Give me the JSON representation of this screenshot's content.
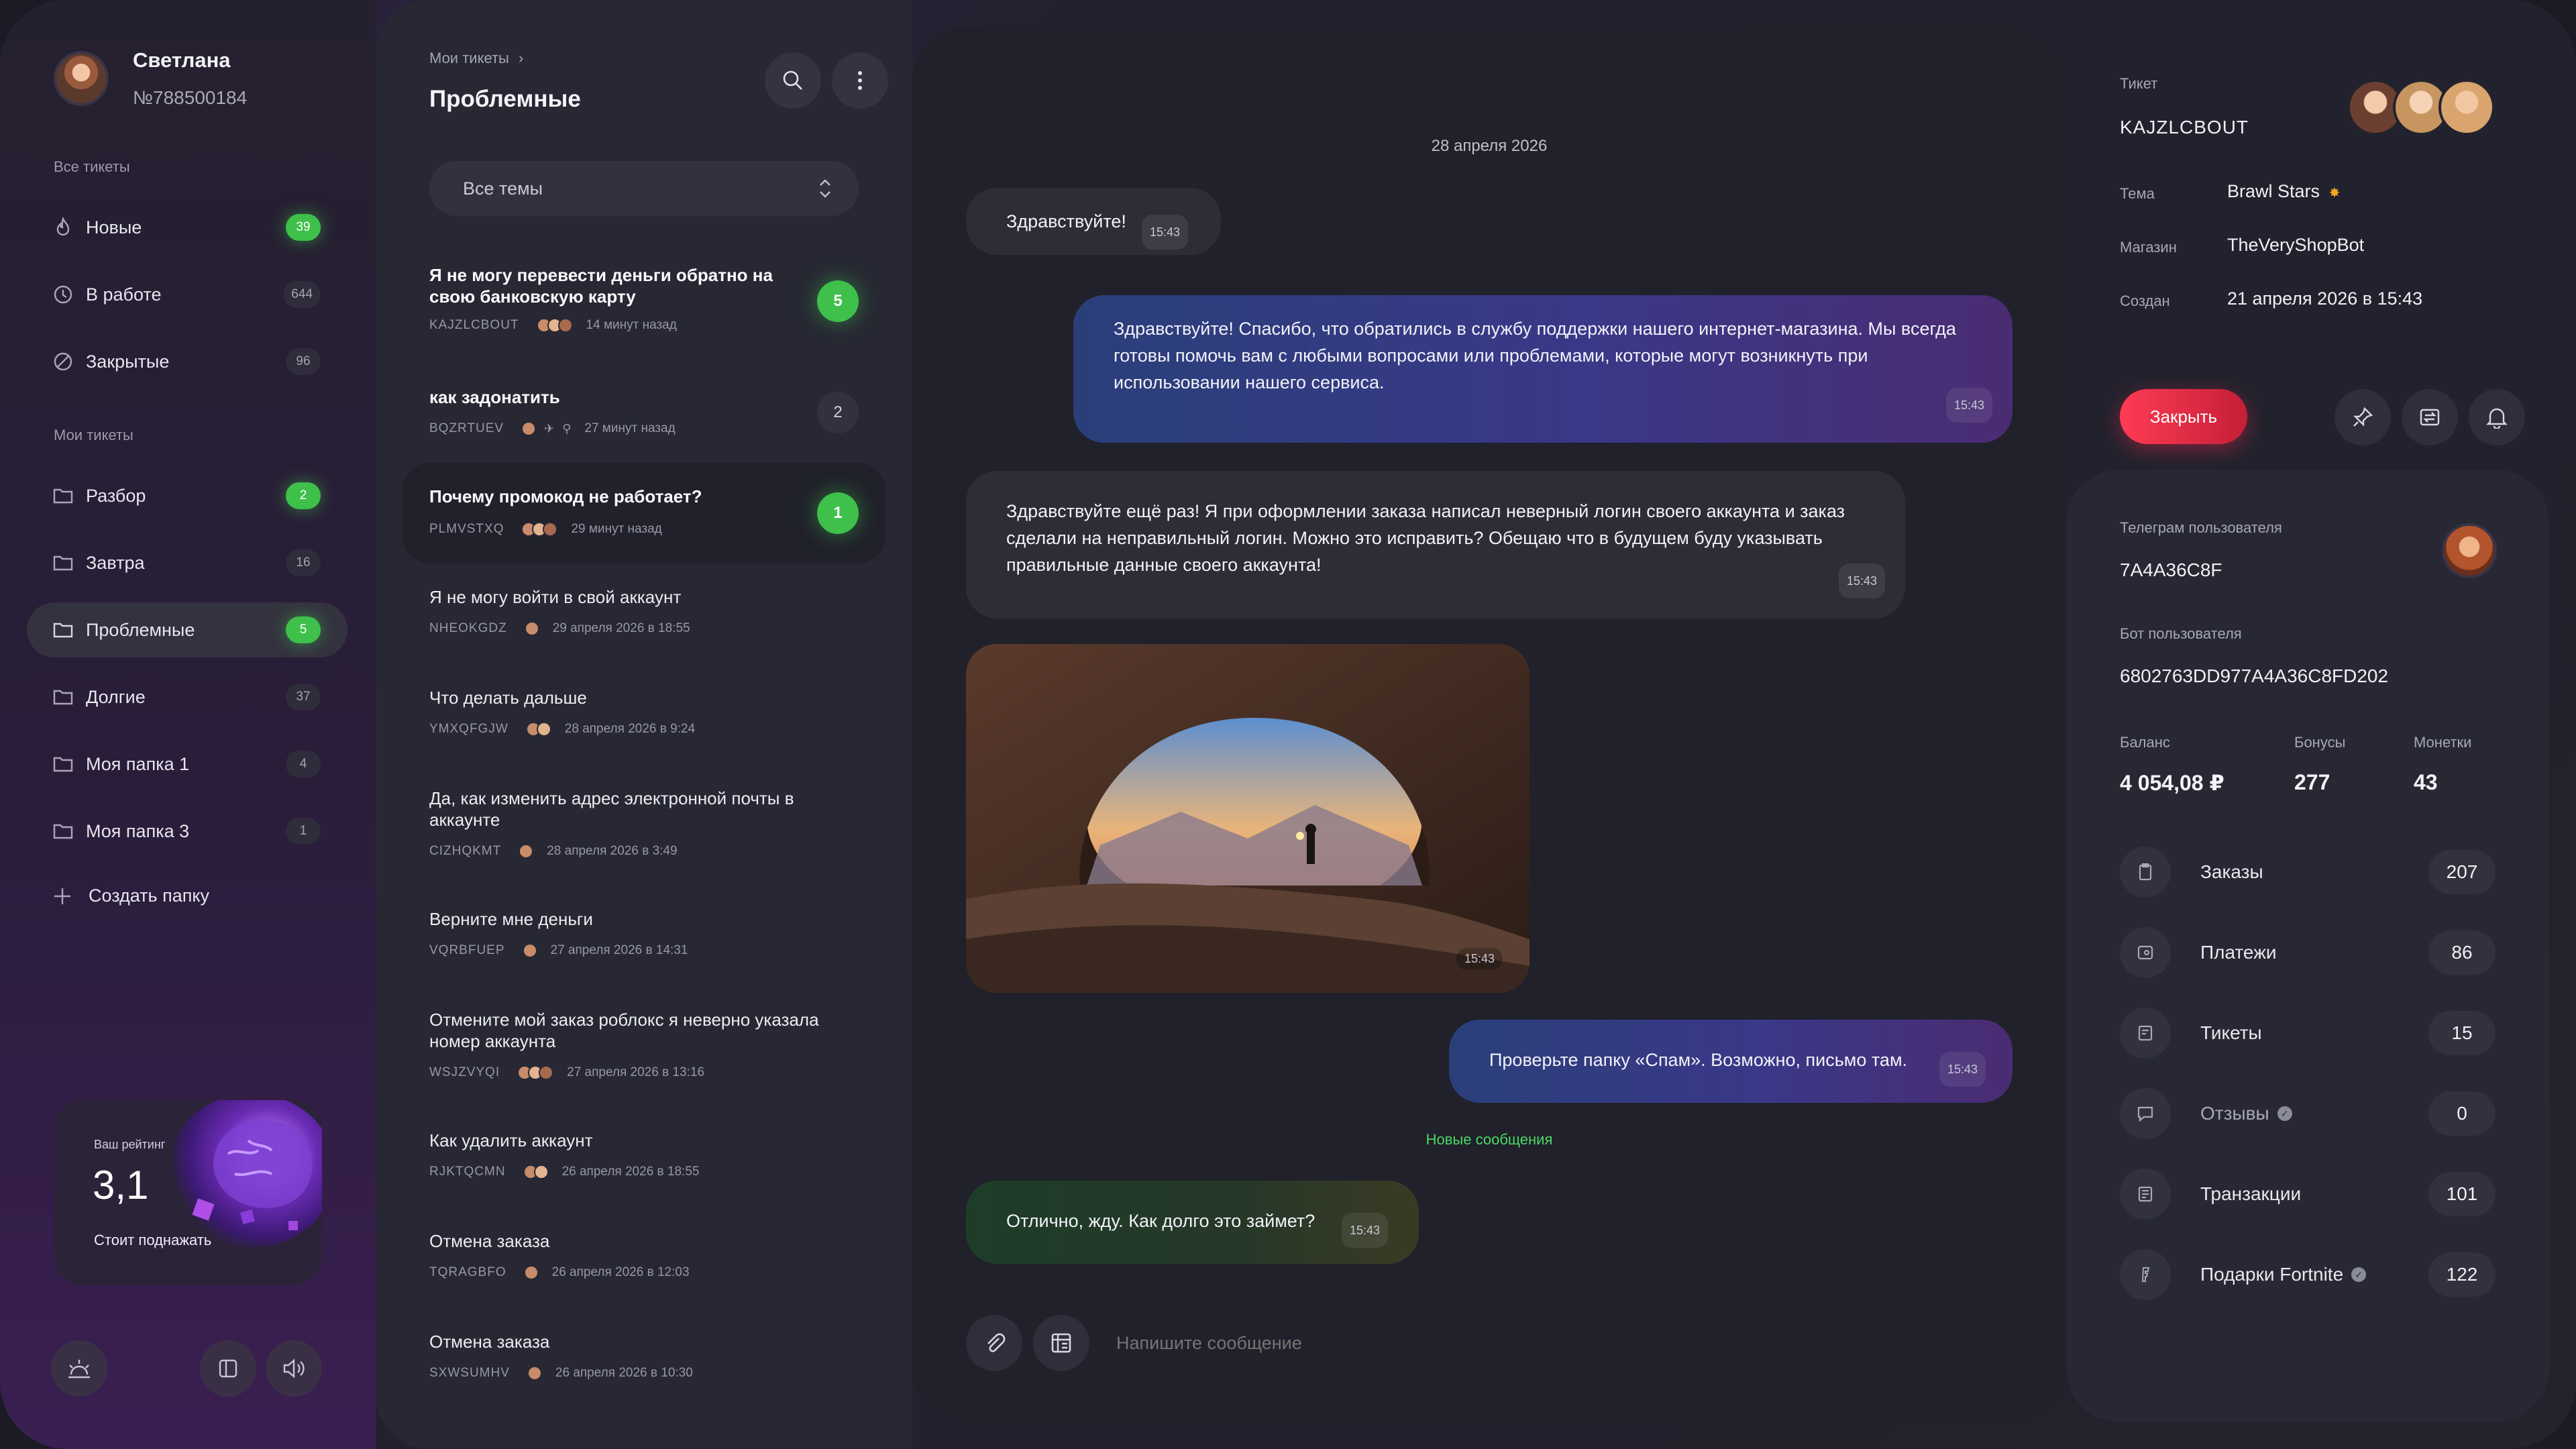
{
  "user": {
    "name": "Светлана",
    "id": "№788500184"
  },
  "sidebar": {
    "all_title": "Все тикеты",
    "my_title": "Мои тикеты",
    "all_items": [
      {
        "label": "Новые",
        "count": "39"
      },
      {
        "label": "В работе",
        "count": "644"
      },
      {
        "label": "Закрытые",
        "count": "96"
      }
    ],
    "my_items": [
      {
        "label": "Разбор",
        "count": "2"
      },
      {
        "label": "Завтра",
        "count": "16"
      },
      {
        "label": "Проблемные",
        "count": "5"
      },
      {
        "label": "Долгие",
        "count": "37"
      },
      {
        "label": "Моя папка 1",
        "count": "4"
      },
      {
        "label": "Моя папка 3",
        "count": "1"
      }
    ],
    "create_folder": "Создать папку",
    "rating": {
      "caption": "Ваш рейтинг",
      "value": "3,1",
      "subtitle": "Стоит поднажать"
    }
  },
  "list": {
    "breadcrumb": "Мои тикеты",
    "title": "Проблемные",
    "filter": "Все темы",
    "tickets": [
      {
        "title": "Я не могу перевести деньги обратно на свою банковскую карту",
        "code": "KAJZLCBOUT",
        "time": "14 минут назад",
        "badge": "5"
      },
      {
        "title": "как задонатить",
        "code": "BQZRTUEV",
        "time": "27 минут назад",
        "badge": "2"
      },
      {
        "title": "Почему промокод не работает?",
        "code": "PLMVSTXQ",
        "time": "29 минут назад",
        "badge": "1"
      },
      {
        "title": "Я не могу войти в свой аккаунт",
        "code": "NHEOKGDZ",
        "time": "29 апреля 2026 в 18:55"
      },
      {
        "title": "Что делать дальше",
        "code": "YMXQFGJW",
        "time": "28 апреля 2026 в 9:24"
      },
      {
        "title": "Да, как изменить адрес электронной почты в аккаунте",
        "code": "CIZHQKMT",
        "time": "28 апреля 2026 в 3:49"
      },
      {
        "title": "Верните мне деньги",
        "code": "VQRBFUEP",
        "time": "27 апреля 2026 в 14:31"
      },
      {
        "title": "Отмените мой заказ роблокс я неверно указала номер аккаунта",
        "code": "WSJZVYQI",
        "time": "27 апреля 2026 в 13:16"
      },
      {
        "title": "Как удалить аккаунт",
        "code": "RJKTQCMN",
        "time": "26 апреля 2026 в 18:55"
      },
      {
        "title": "Отмена заказа",
        "code": "TQRAGBFO",
        "time": "26 апреля 2026 в 12:03"
      },
      {
        "title": "Отмена заказа",
        "code": "SXWSUMHV",
        "time": "26 апреля 2026 в 10:30"
      }
    ]
  },
  "chat": {
    "date": "28 апреля 2026",
    "messages": [
      {
        "text": "Здравствуйте!",
        "time": "15:43"
      },
      {
        "text": "Здравствуйте! Спасибо, что обратились в службу поддержки нашего интернет-магазина. Мы всегда готовы помочь вам с любыми вопросами или проблемами, которые могут возникнуть при использовании нашего сервиса.",
        "time": "15:43"
      },
      {
        "text": "Здравствуйте ещё раз! Я при оформлении заказа написал неверный логин своего аккаунта и заказ сделали на неправильный логин. Можно это исправить? Обещаю что в будущем буду указывать правильные данные своего аккаунта!",
        "time": "15:43"
      },
      {
        "text": "",
        "time": "15:43"
      },
      {
        "text": "Проверьте папку «Спам». Возможно, письмо там.",
        "time": "15:43"
      },
      {
        "text": "Отлично, жду. Как долго это займет?",
        "time": "15:43"
      }
    ],
    "new_messages": "Новые сообщения",
    "placeholder": "Напишите сообщение"
  },
  "info": {
    "ticket_label": "Тикет",
    "ticket_id": "KAJZLCBOUT",
    "topic_label": "Тема",
    "topic": "Brawl Stars",
    "shop_label": "Магазин",
    "shop": "TheVeryShopBot",
    "created_label": "Создан",
    "created": "21 апреля 2026 в 15:43",
    "close_button": "Закрыть",
    "telegram_label": "Телеграм пользователя",
    "telegram": "7A4A36C8F",
    "bot_label": "Бот пользователя",
    "bot": "6802763DD977A4A36C8FD202",
    "balance_label": "Баланс",
    "balance": "4 054,08 ₽",
    "bonuses_label": "Бонусы",
    "bonuses": "277",
    "coins_label": "Монетки",
    "coins": "43",
    "stats": [
      {
        "label": "Заказы",
        "value": "207"
      },
      {
        "label": "Платежи",
        "value": "86"
      },
      {
        "label": "Тикеты",
        "value": "15"
      },
      {
        "label": "Отзывы",
        "value": "0"
      },
      {
        "label": "Транзакции",
        "value": "101"
      },
      {
        "label": "Подарки Fortnite",
        "value": "122"
      }
    ]
  },
  "colors": {
    "accent_green": "#3ec04a",
    "close_red": "#e8304a",
    "outgoing_blue": "#2a3f7a"
  }
}
